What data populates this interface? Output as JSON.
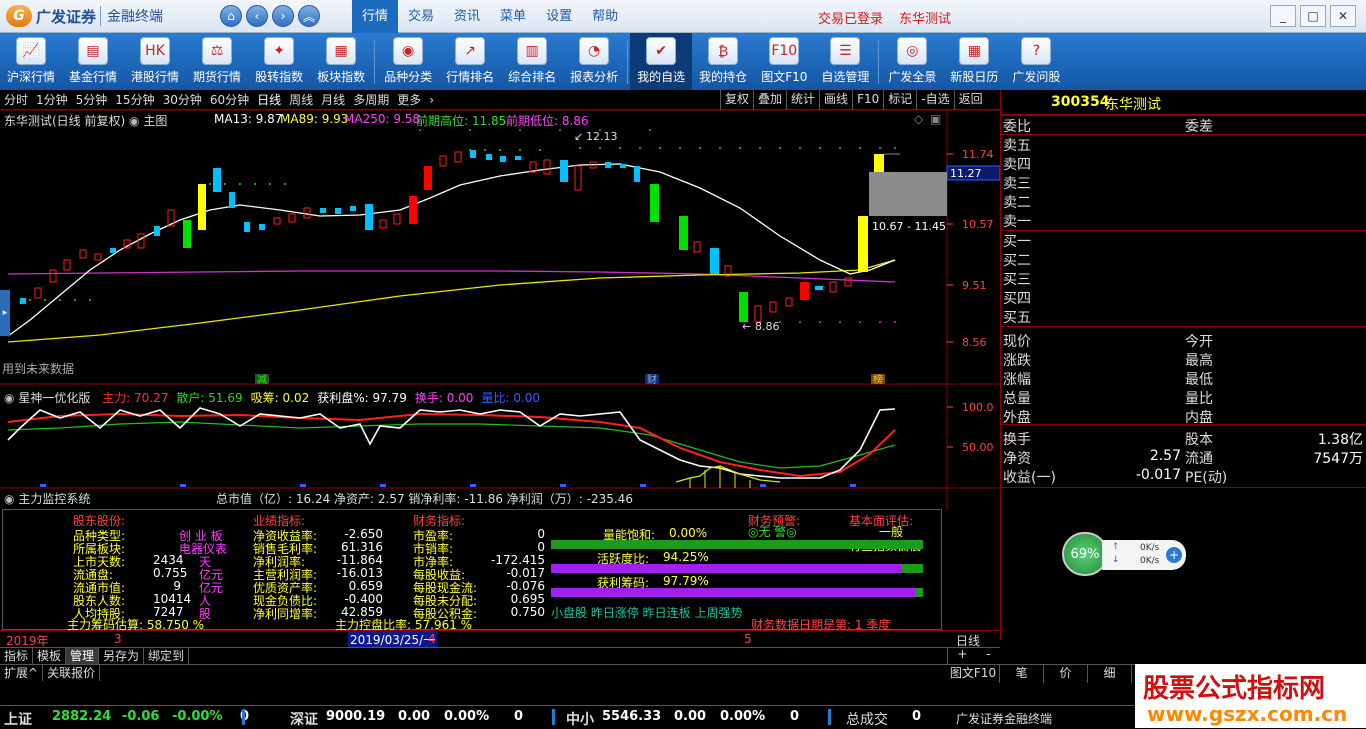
{
  "app": {
    "logo_text": "广发证券",
    "logo_sub": "金融终端",
    "mainmenu": [
      "行情",
      "交易",
      "资讯",
      "菜单",
      "设置",
      "帮助"
    ],
    "status_login": "交易已登录",
    "status_user": "东华测试"
  },
  "toolbar": [
    "沪深行情",
    "基金行情",
    "港股行情",
    "期货行情",
    "股转指数",
    "板块指数",
    "品种分类",
    "行情排名",
    "综合排名",
    "报表分析",
    "我的自选",
    "我的持仓",
    "图文F10",
    "自选管理",
    "广发全景",
    "新股日历",
    "广发问股"
  ],
  "periods": [
    "分时",
    "1分钟",
    "5分钟",
    "15分钟",
    "30分钟",
    "60分钟",
    "日线",
    "周线",
    "月线",
    "多周期",
    "更多"
  ],
  "rtools": [
    "复权",
    "叠加",
    "统计",
    "画线",
    "F10",
    "标记",
    "-自选",
    "返回"
  ],
  "stock": {
    "code": "300354",
    "name": "东华测试"
  },
  "main_chart": {
    "title": "东华测试(日线 前复权)",
    "panel": "主图",
    "ma13": "MA13: 9.87",
    "ma89": "MA89: 9.93",
    "ma250": "MA250: 9.58",
    "high_label": "前期高位: 11.85",
    "low_label": "前期低位: 8.86",
    "peak": "12.13",
    "trough": "8.86",
    "range_label": "10.67 - 11.45",
    "price_marker": "11.27",
    "future_note": "用到未来数据",
    "events": [
      "减",
      "财",
      "榜"
    ]
  },
  "chart_data": [
    {
      "type": "candlestick",
      "title": "东华测试(日线 前复权)",
      "yticks": [
        "11.74",
        "10.57",
        "9.51",
        "8.56"
      ],
      "series": [
        {
          "name": "MA13",
          "value": 9.87
        },
        {
          "name": "MA89",
          "value": 9.93
        },
        {
          "name": "MA250",
          "value": 9.58
        }
      ],
      "peak": 12.13,
      "trough": 8.86
    },
    {
      "type": "line",
      "title": "星神一优化版",
      "series": [
        {
          "name": "主力",
          "value": 70.27
        },
        {
          "name": "散户",
          "value": 51.69
        },
        {
          "name": "吸筹",
          "value": 0.02
        },
        {
          "name": "获利盘%",
          "value": 97.79
        },
        {
          "name": "换手",
          "value": 0.0
        },
        {
          "name": "量比",
          "value": 0.0
        }
      ],
      "yticks": [
        "100.0",
        "50.00"
      ]
    }
  ],
  "indicator": {
    "title": "星神一优化版",
    "items": [
      {
        "k": "主力",
        "v": "70.27",
        "c": "#ff3030"
      },
      {
        "k": "散户",
        "v": "51.69",
        "c": "#30d030"
      },
      {
        "k": "吸筹",
        "v": "0.02",
        "c": "#ffff30"
      },
      {
        "k": "获利盘%",
        "v": "97.79",
        "c": "#ffffff"
      },
      {
        "k": "换手",
        "v": "0.00",
        "c": "#ff40ff"
      },
      {
        "k": "量比",
        "v": "0.00",
        "c": "#3060ff"
      }
    ]
  },
  "monitor": {
    "title": "主力监控系统",
    "summary": "总市值（亿）: 16.24  净资产: 2.57  销净利率: -11.86  净利润（万）: -235.46"
  },
  "fund": {
    "h1": "股东股份:",
    "h2": "业绩指标:",
    "h3": "财务指标:",
    "h4": "财务预警:",
    "h5": "基本面评估:",
    "c1": [
      [
        "品种类型:",
        "创 业 板"
      ],
      [
        "所属板块:",
        "电器仪表"
      ],
      [
        "上市天数:",
        "2434",
        "天"
      ],
      [
        "流通盘:",
        "0.755",
        "亿元"
      ],
      [
        "流通市值:",
        "9",
        "亿元"
      ],
      [
        "股东人数:",
        "10414",
        "人"
      ],
      [
        "人均持股:",
        "7247",
        "股"
      ]
    ],
    "c2": [
      [
        "净资收益率:",
        "-2.650"
      ],
      [
        "销售毛利率:",
        "61.316"
      ],
      [
        "净利润率:",
        "-11.864"
      ],
      [
        "主营利润率:",
        "-16.013"
      ],
      [
        "优质资产率:",
        "0.659"
      ],
      [
        "现金负债比:",
        "-0.400"
      ],
      [
        "净利同增率:",
        "42.859"
      ]
    ],
    "c3": [
      [
        "市盈率:",
        "0"
      ],
      [
        "市销率:",
        "0"
      ],
      [
        "市净率:",
        "-172.415"
      ],
      [
        "每股收益:",
        "-0.017"
      ],
      [
        "每股现金流:",
        "-0.076"
      ],
      [
        "每股未分配:",
        "0.695"
      ],
      [
        "每股公积金:",
        "0.750"
      ]
    ],
    "warn": "◎无 警◎",
    "eval1": "一般",
    "eval2": "有些指数偏低",
    "bars": [
      {
        "k": "量能饱和:",
        "v": "0.00%",
        "f": 0
      },
      {
        "k": "活跃度比:",
        "v": "94.25%",
        "f": 0.9425
      },
      {
        "k": "获利筹码:",
        "v": "97.79%",
        "f": 0.9779
      }
    ],
    "foot1": "主力筹码估算: 58.750 %",
    "foot2": "主力控盘比率: 57.961 %",
    "foot3": "财务数据日期是第: 1 季度",
    "tags": "小盘股 昨日涨停 昨日连板 上周强势"
  },
  "quote": {
    "weibi": "委比",
    "weicha": "委差",
    "asks": [
      "卖五",
      "卖四",
      "卖三",
      "卖二",
      "卖一"
    ],
    "bids": [
      "买一",
      "买二",
      "买三",
      "买四",
      "买五"
    ],
    "left": [
      "现价",
      "涨跌",
      "涨幅",
      "总量",
      "外盘"
    ],
    "right": [
      "今开",
      "最高",
      "最低",
      "量比",
      "内盘"
    ],
    "r2": [
      [
        "换手",
        "",
        "股本",
        "1.38亿"
      ],
      [
        "净资",
        "2.57",
        "流通",
        "7547万"
      ],
      [
        "收益(一)",
        "-0.017",
        "PE(动)",
        ""
      ]
    ]
  },
  "netwidget": {
    "pct": "69%",
    "up": "0K/s",
    "down": "0K/s"
  },
  "timeline": {
    "year": "2019年",
    "m3": "3",
    "date": "2019/03/25/一",
    "m4": "4",
    "m5": "5",
    "period": "日线"
  },
  "tabs": [
    "指标",
    "模板",
    "管理",
    "另存为",
    "绑定到"
  ],
  "bottom3": [
    "扩展^",
    "关联报价"
  ],
  "right_tabs": [
    "图文F10",
    "笔",
    "价",
    "细"
  ],
  "ticker": [
    {
      "name": "上证",
      "v": "2882.24",
      "c": "-0.06",
      "p": "-0.00%",
      "x": "0"
    },
    {
      "name": "深证",
      "v": "9000.19",
      "c": "0.00",
      "p": "0.00%",
      "x": "0"
    },
    {
      "name": "中小",
      "v": "5546.33",
      "c": "0.00",
      "p": "0.00%",
      "x": "0"
    }
  ],
  "ticker_total": "总成交",
  "ticker_total_v": "0",
  "ticker_brand": "广发证券金融终端",
  "watermark": {
    "t1": "股票公式指标网",
    "t2": "www.gszx.com.cn"
  }
}
